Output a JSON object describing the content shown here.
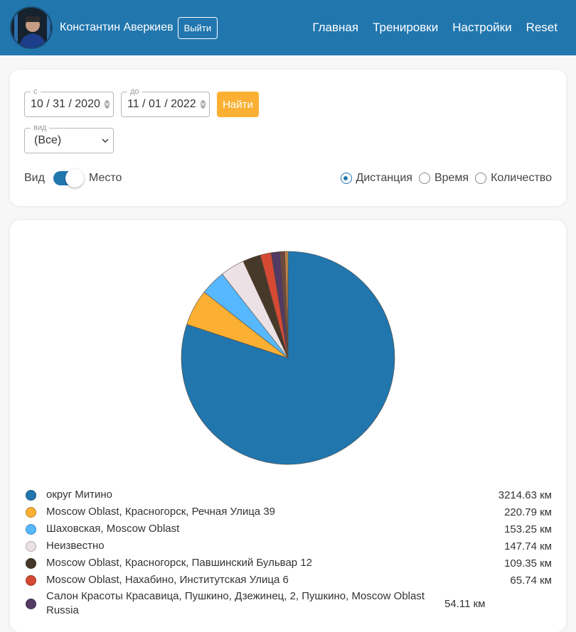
{
  "header": {
    "user_name": "Константин Аверкиев",
    "logout_label": "Выйти",
    "nav": [
      "Главная",
      "Тренировки",
      "Настройки",
      "Reset"
    ]
  },
  "filters": {
    "from_label": "с",
    "from_value": "10 / 31 / 2020",
    "to_label": "до",
    "to_value": "11 / 01 / 2022",
    "find_label": "Найти",
    "type_label": "вид",
    "type_value": "(Все)",
    "toggle_left": "Вид",
    "toggle_right": "Место",
    "radios": [
      "Дистанция",
      "Время",
      "Количество"
    ],
    "radio_selected": "Дистанция"
  },
  "chart_data": {
    "type": "pie",
    "unit": "км",
    "slices": [
      {
        "label": "округ Митино",
        "value": 3214.63,
        "display": "3214.63 км",
        "color": "#2176ae"
      },
      {
        "label": "Moscow Oblast, Красногорск, Речная Улица 39",
        "value": 220.79,
        "display": "220.79 км",
        "color": "#fbb034"
      },
      {
        "label": "Шаховская, Moscow Oblast",
        "value": 153.25,
        "display": "153.25 км",
        "color": "#57b8ff"
      },
      {
        "label": "Неизвестно",
        "value": 147.74,
        "display": "147.74 км",
        "color": "#ece2e6"
      },
      {
        "label": "Moscow Oblast, Красногорск, Павшинский Бульвар 12",
        "value": 109.35,
        "display": "109.35 км",
        "color": "#46392a"
      },
      {
        "label": "Moscow Oblast, Нахабино, Институтская Улица 6",
        "value": 65.74,
        "display": "65.74 км",
        "color": "#d64933"
      },
      {
        "label": "Салон Красоты Красавица, Пушкино, Дзежинец, 2, Пушкино, Moscow Oblast Russia",
        "value": 54.11,
        "display": "54.11 км",
        "color": "#533a64"
      },
      {
        "value": 30.0,
        "color": "#6b4b3e"
      },
      {
        "value": 12.0,
        "color": "#e88d4f"
      },
      {
        "value": 6.0,
        "color": "#f2c14e"
      }
    ]
  }
}
